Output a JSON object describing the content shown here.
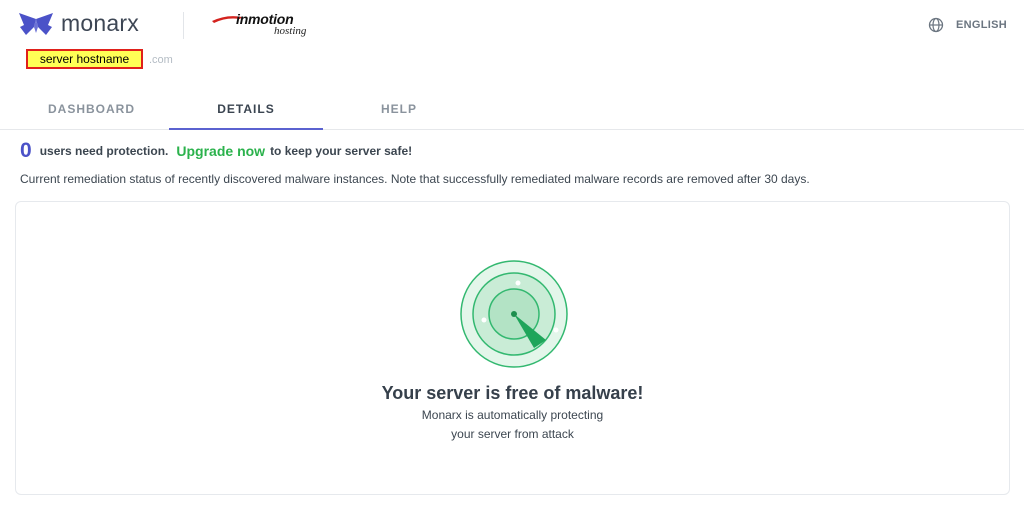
{
  "brand": {
    "name": "monarx",
    "partner_main": "inmotion",
    "partner_sub": "hosting"
  },
  "host": {
    "label": "server hostname",
    "obscured_suffix": ".com"
  },
  "language": {
    "label": "ENGLISH",
    "icon": "globe-icon"
  },
  "tabs": [
    {
      "label": "DASHBOARD",
      "active": false
    },
    {
      "label": "DETAILS",
      "active": true
    },
    {
      "label": "HELP",
      "active": false
    }
  ],
  "protection": {
    "count": "0",
    "text": "users need protection.",
    "upgrade_label": "Upgrade now",
    "suffix": "to keep your server safe!"
  },
  "description": "Current remediation status of recently discovered malware instances. Note that successfully remediated malware records are removed after 30 days.",
  "status": {
    "title": "Your server is free of malware!",
    "line1": "Monarx is automatically protecting",
    "line2": "your server from attack",
    "icon": "radar-icon"
  },
  "colors": {
    "accent": "#4b52c8",
    "upgrade": "#2bb24c",
    "radar": "#2fb36b",
    "highlight": "#ffff55",
    "highlight_border": "#e0201a"
  }
}
